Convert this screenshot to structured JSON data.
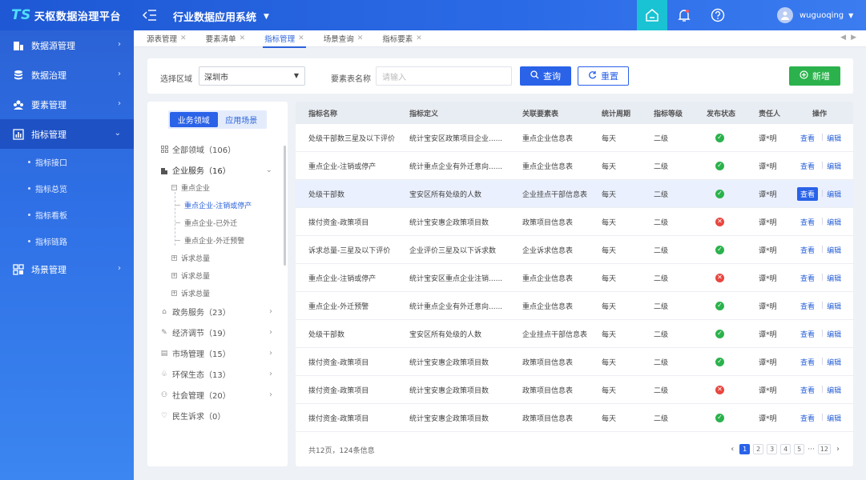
{
  "app": {
    "logo_mark": "TS",
    "logo_text": "天枢数据治理平台",
    "system_title": "行业数据应用系统",
    "username": "wuguoqing"
  },
  "sidebar": {
    "items": [
      {
        "label": "数据源管理",
        "icon": "database-source-icon"
      },
      {
        "label": "数据治理",
        "icon": "database-stack-icon"
      },
      {
        "label": "要素管理",
        "icon": "users-group-icon"
      },
      {
        "label": "指标管理",
        "icon": "bar-chart-icon",
        "active": true
      },
      {
        "label": "场景管理",
        "icon": "grid-apps-icon"
      }
    ],
    "sub_items": [
      "指标接口",
      "指标总览",
      "指标看板",
      "指标链路"
    ]
  },
  "tabs": [
    {
      "label": "源表管理"
    },
    {
      "label": "要素清单"
    },
    {
      "label": "指标管理",
      "active": true
    },
    {
      "label": "场景查询"
    },
    {
      "label": "指标要素"
    }
  ],
  "filter": {
    "region_label": "选择区域",
    "region_value": "深圳市",
    "name_label": "要素表名称",
    "name_placeholder": "请输入",
    "query_label": "查询",
    "reset_label": "重置",
    "add_label": "新增"
  },
  "tree": {
    "segments": [
      {
        "label": "业务领域",
        "active": true
      },
      {
        "label": "应用场景"
      }
    ],
    "all": {
      "label": "全部领域",
      "count": "（106）"
    },
    "enterprise": {
      "label": "企业服务",
      "count": "（16）"
    },
    "key_enterprise": "重点企业",
    "leaves": [
      "重点企业-注销或停产",
      "重点企业-已外迁",
      "重点企业-外迁预警"
    ],
    "complaints": [
      "诉求总量",
      "诉求总量",
      "诉求总量"
    ],
    "categories": [
      {
        "label": "政务服务",
        "count": "（23）"
      },
      {
        "label": "经济调节",
        "count": "（19）"
      },
      {
        "label": "市场管理",
        "count": "（15）"
      },
      {
        "label": "环保生态",
        "count": "（13）"
      },
      {
        "label": "社会管理",
        "count": "（20）"
      },
      {
        "label": "民生诉求",
        "count": "（0）"
      }
    ]
  },
  "table": {
    "columns": [
      "指标名称",
      "指标定义",
      "关联要素表",
      "统计周期",
      "指标等级",
      "发布状态",
      "责任人",
      "操作"
    ],
    "view_label": "查看",
    "edit_label": "编辑",
    "rows": [
      {
        "name": "处级干部数三星及以下评价",
        "def": "统计宝安区政策项目企业......",
        "table": "重点企业信息表",
        "period": "每天",
        "level": "二级",
        "status": "ok",
        "owner": "谭*明"
      },
      {
        "name": "重点企业-注销或停产",
        "def": "统计重点企业有外迁意向......",
        "table": "重点企业信息表",
        "period": "每天",
        "level": "二级",
        "status": "ok",
        "owner": "谭*明"
      },
      {
        "name": "处级干部数",
        "def": "宝安区所有处级的人数",
        "table": "企业挂点干部信息表",
        "period": "每天",
        "level": "二级",
        "status": "ok",
        "owner": "谭*明",
        "highlight": true
      },
      {
        "name": "拨付资金-政策项目",
        "def": "统计宝安惠企政策项目数",
        "table": "政策项目信息表",
        "period": "每天",
        "level": "二级",
        "status": "no",
        "owner": "谭*明"
      },
      {
        "name": "诉求总量-三星及以下评价",
        "def": "企业评价三星及以下诉求数",
        "table": "企业诉求信息表",
        "period": "每天",
        "level": "二级",
        "status": "ok",
        "owner": "谭*明"
      },
      {
        "name": "重点企业-注销或停产",
        "def": "统计宝安区重点企业注销......",
        "table": "重点企业信息表",
        "period": "每天",
        "level": "二级",
        "status": "no",
        "owner": "谭*明"
      },
      {
        "name": "重点企业-外迁预警",
        "def": "统计重点企业有外迁意向......",
        "table": "重点企业信息表",
        "period": "每天",
        "level": "二级",
        "status": "ok",
        "owner": "谭*明"
      },
      {
        "name": "处级干部数",
        "def": "宝安区所有处级的人数",
        "table": "企业挂点干部信息表",
        "period": "每天",
        "level": "二级",
        "status": "ok",
        "owner": "谭*明"
      },
      {
        "name": "拨付资金-政策项目",
        "def": "统计宝安惠企政策项目数",
        "table": "政策项目信息表",
        "period": "每天",
        "level": "二级",
        "status": "ok",
        "owner": "谭*明"
      },
      {
        "name": "拨付资金-政策项目",
        "def": "统计宝安惠企政策项目数",
        "table": "政策项目信息表",
        "period": "每天",
        "level": "二级",
        "status": "no",
        "owner": "谭*明"
      },
      {
        "name": "拨付资金-政策项目",
        "def": "统计宝安惠企政策项目数",
        "table": "政策项目信息表",
        "period": "每天",
        "level": "二级",
        "status": "ok",
        "owner": "谭*明"
      }
    ]
  },
  "pagination": {
    "info": "共12页，124条信息",
    "pages": [
      "1",
      "2",
      "3",
      "4",
      "5"
    ],
    "dots": "···",
    "last": "12",
    "current": "1"
  },
  "colors": {
    "primary": "#2a62e8",
    "success": "#2bb24c",
    "danger": "#e8463f",
    "home_accent": "#19c3d3"
  }
}
